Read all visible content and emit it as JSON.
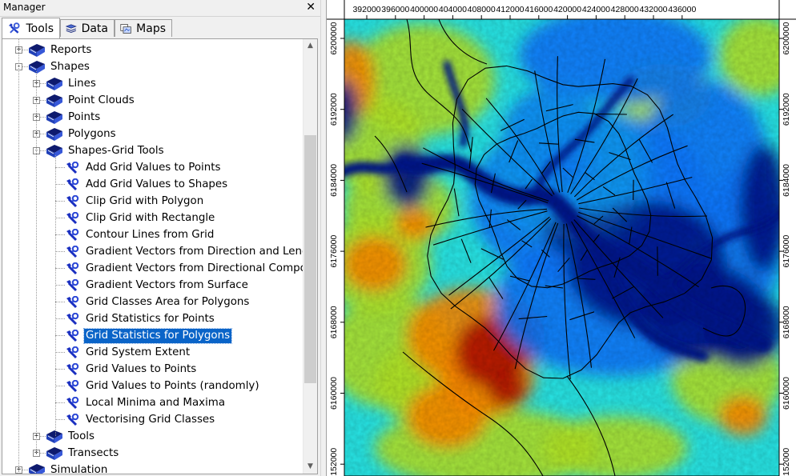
{
  "manager": {
    "title": "Manager",
    "close_glyph": "✕",
    "tabs": [
      {
        "label": "Tools",
        "icon": "tools-icon",
        "active": true
      },
      {
        "label": "Data",
        "icon": "data-stack-icon",
        "active": false
      },
      {
        "label": "Maps",
        "icon": "maps-icon",
        "active": false
      }
    ],
    "tree": [
      {
        "label": "Reports",
        "level": 0,
        "expander": "+",
        "icon": "library-book-icon"
      },
      {
        "label": "Shapes",
        "level": 0,
        "expander": "-",
        "icon": "library-book-icon"
      },
      {
        "label": "Lines",
        "level": 1,
        "expander": "+",
        "icon": "library-book-icon"
      },
      {
        "label": "Point Clouds",
        "level": 1,
        "expander": "+",
        "icon": "library-book-icon"
      },
      {
        "label": "Points",
        "level": 1,
        "expander": "+",
        "icon": "library-book-icon"
      },
      {
        "label": "Polygons",
        "level": 1,
        "expander": "+",
        "icon": "library-book-icon"
      },
      {
        "label": "Shapes-Grid Tools",
        "level": 1,
        "expander": "-",
        "icon": "library-book-icon"
      },
      {
        "label": "Add Grid Values to Points",
        "level": 2,
        "icon": "tool-gear-icon"
      },
      {
        "label": "Add Grid Values to Shapes",
        "level": 2,
        "icon": "tool-gear-icon"
      },
      {
        "label": "Clip Grid with Polygon",
        "level": 2,
        "icon": "tool-gear-icon"
      },
      {
        "label": "Clip Grid with Rectangle",
        "level": 2,
        "icon": "tool-gear-icon"
      },
      {
        "label": "Contour Lines from Grid",
        "level": 2,
        "icon": "tool-gear-icon"
      },
      {
        "label": "Gradient Vectors from Direction and Length",
        "level": 2,
        "icon": "tool-gear-icon"
      },
      {
        "label": "Gradient Vectors from Directional Components",
        "level": 2,
        "icon": "tool-gear-icon"
      },
      {
        "label": "Gradient Vectors from Surface",
        "level": 2,
        "icon": "tool-gear-icon"
      },
      {
        "label": "Grid Classes Area for Polygons",
        "level": 2,
        "icon": "tool-gear-icon"
      },
      {
        "label": "Grid Statistics for Points",
        "level": 2,
        "icon": "tool-gear-icon"
      },
      {
        "label": "Grid Statistics for Polygons",
        "level": 2,
        "icon": "tool-gear-icon",
        "selected": true
      },
      {
        "label": "Grid System Extent",
        "level": 2,
        "icon": "tool-gear-icon"
      },
      {
        "label": "Grid Values to Points",
        "level": 2,
        "icon": "tool-gear-icon"
      },
      {
        "label": "Grid Values to Points (randomly)",
        "level": 2,
        "icon": "tool-gear-icon"
      },
      {
        "label": "Local Minima and Maxima",
        "level": 2,
        "icon": "tool-gear-icon"
      },
      {
        "label": "Vectorising Grid Classes",
        "level": 2,
        "icon": "tool-gear-icon"
      },
      {
        "label": "Tools",
        "level": 1,
        "expander": "+",
        "icon": "library-book-icon"
      },
      {
        "label": "Transects",
        "level": 1,
        "expander": "+",
        "icon": "library-book-icon"
      },
      {
        "label": "Simulation",
        "level": 0,
        "expander": "+",
        "icon": "library-book-icon"
      }
    ],
    "scrollbar": {
      "up_glyph": "▲",
      "down_glyph": "▼"
    }
  },
  "map": {
    "x_ticks": [
      "392000",
      "396000",
      "400000",
      "404000",
      "408000",
      "412000",
      "416000",
      "420000",
      "424000",
      "428000",
      "432000",
      "436000"
    ],
    "y_ticks": [
      "6200000",
      "6192000",
      "6184000",
      "6176000",
      "6168000",
      "6160000",
      "6152000"
    ],
    "colors": {
      "low": "#00148c",
      "mid_low": "#0a78ff",
      "mid": "#28e6e6",
      "mid_high": "#b4e628",
      "high": "#ff8c00",
      "peak": "#b41400",
      "boundaries": "#000000",
      "frame": "#000000"
    }
  }
}
